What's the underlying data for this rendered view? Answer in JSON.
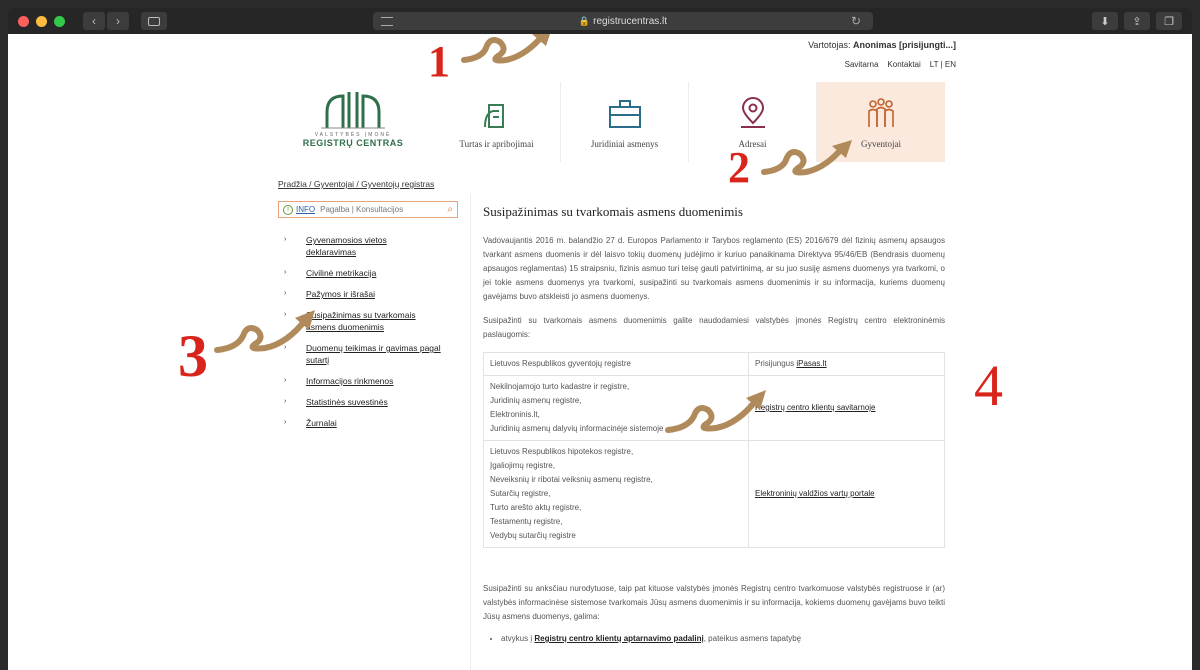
{
  "browser": {
    "url": "registrucentras.lt",
    "back": "‹",
    "forward": "›",
    "reload": "↻"
  },
  "header": {
    "user_prefix": "Vartotojas:",
    "user_name": "Anonimas",
    "login": "[prisijungti...]",
    "links": [
      "Savitarna",
      "Kontaktai",
      "LT | EN"
    ]
  },
  "logo": {
    "line1": "VALSTYBĖS ĮMONĖ",
    "line2": "REGISTRŲ CENTRAS",
    "color": "#2f6f4a"
  },
  "categories": [
    {
      "label": "Turtas ir apribojimai",
      "icon": "property-icon"
    },
    {
      "label": "Juridiniai asmenys",
      "icon": "briefcase-icon"
    },
    {
      "label": "Adresai",
      "icon": "location-pin-icon"
    },
    {
      "label": "Gyventojai",
      "icon": "people-icon",
      "active": true
    }
  ],
  "breadcrumb": "Pradžia / Gyventojai / Gyventojų registras",
  "search": {
    "info": "INFO",
    "placeholder": "Pagalba | Konsultacijos"
  },
  "sidebar": {
    "items": [
      "Gyvenamosios vietos deklaravimas",
      "Civilinė metrikacija",
      "Pažymos ir išrašai",
      "Susipažinimas su tvarkomais asmens duomenimis",
      "Duomenų teikimas ir gavimas pagal sutartį",
      "Informacijos rinkmenos",
      "Statistinės suvestinės",
      "Žurnalai"
    ]
  },
  "content": {
    "title": "Susipažinimas su tvarkomais asmens duomenimis",
    "para1": "Vadovaujantis 2016 m. balandžio 27 d. Europos Parlamento ir Tarybos reglamento (ES) 2016/679 dėl fizinių asmenų apsaugos tvarkant asmens duomenis ir dėl laisvo tokių duomenų judėjimo ir kuriuo panaikinama Direktyva 95/46/EB (Bendrasis duomenų apsaugos reglamentas) 15 straipsniu, fizinis asmuo turi teisę gauti patvirtinimą, ar su juo susiję asmens duomenys yra tvarkomi, o jei tokie asmens duomenys yra tvarkomi, susipažinti su tvarkomais asmens duomenimis ir su informacija, kuriems duomenų gavėjams buvo atskleisti jo asmens duomenys.",
    "para2": "Susipažinti su tvarkomais asmens duomenimis galite naudodamiesi valstybės įmonės Registrų centro elektroninėmis paslaugomis:",
    "table": [
      {
        "left": "Lietuvos Respublikos gyventojų registre",
        "right_prefix": "Prisijungus ",
        "right_link": "iPasas.lt"
      },
      {
        "left": "Nekilnojamojo turto kadastre ir registre,\nJuridinių asmenų registre,\nElektroninis.lt,\nJuridinių asmenų dalyvių informacinėje sistemoje",
        "right_prefix": "",
        "right_link": "Registrų centro klientų savitarnoje"
      },
      {
        "left": "Lietuvos Respublikos hipotekos registre,\nĮgaliojimų registre,\nNeveiksnių ir ribotai veiksnių asmenų registre,\nSutarčių registre,\nTurto arešto aktų registre,\nTestamentų registre,\nVedybų sutarčių registre",
        "right_prefix": "",
        "right_link": "Elektroninių valdžios vartų portale"
      }
    ],
    "para3": "Susipažinti su anksčiau nurodytuose, taip pat kituose valstybės įmonės Registrų centro tvarkomuose valstybės registruose ir (ar) valstybės informacinėse sistemose tvarkomais Jūsų asmens duomenimis ir su informacija, kokiems duomenų gavėjams buvo teikti Jūsų asmens duomenys, galima:",
    "bullet_prefix": "atvykus į ",
    "bullet_link": "Registrų centro klientų aptarnavimo padalinį",
    "bullet_suffix": ", pateikus asmens tapatybę"
  },
  "annotations": {
    "numbers": [
      "1",
      "2",
      "3",
      "4"
    ],
    "number_color": "#d9241c",
    "arrow_color": "#b08a5a"
  }
}
